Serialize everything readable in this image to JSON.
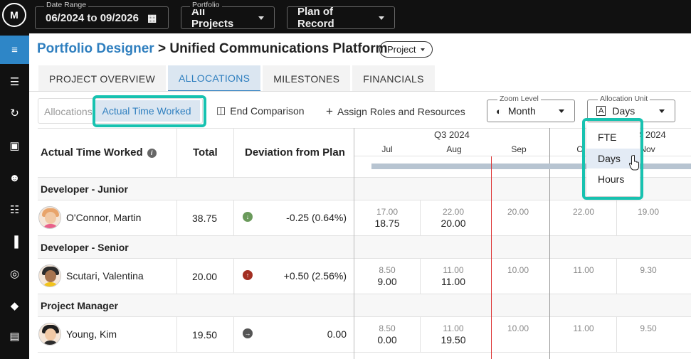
{
  "topbar": {
    "logo_text": "M",
    "date_range": {
      "legend": "Date Range",
      "value": "06/2024 to 09/2026"
    },
    "portfolio": {
      "legend": "Portfolio",
      "value": "All Projects"
    },
    "plan": {
      "value": "Plan of Record"
    }
  },
  "sidebar": {
    "items": [
      {
        "icon": "menu-lines-icon",
        "glyph": "≡",
        "active": true
      },
      {
        "icon": "person-list-icon",
        "glyph": "☰"
      },
      {
        "icon": "refresh-icon",
        "glyph": "↻"
      },
      {
        "icon": "badge-icon",
        "glyph": "▣"
      },
      {
        "icon": "people-icon",
        "glyph": "☻"
      },
      {
        "icon": "list-icon",
        "glyph": "☷"
      },
      {
        "icon": "columns-icon",
        "glyph": "▐"
      },
      {
        "icon": "target-icon",
        "glyph": "◎"
      },
      {
        "icon": "diamond-direction-icon",
        "glyph": "◆"
      },
      {
        "icon": "document-icon",
        "glyph": "▤"
      }
    ]
  },
  "header": {
    "breadcrumb": "Portfolio Designer",
    "separator": ">",
    "title": "Unified Communications Platform",
    "badge": "Project"
  },
  "tabs": [
    {
      "label": "PROJECT OVERVIEW"
    },
    {
      "label": "ALLOCATIONS",
      "active": true
    },
    {
      "label": "MILESTONES"
    },
    {
      "label": "FINANCIALS"
    }
  ],
  "toolbar": {
    "seg_allocations": "Allocations",
    "seg_actual": "Actual Time Worked",
    "end_comparison": "End Comparison",
    "assign_roles": "Assign Roles and Resources",
    "zoom": {
      "legend": "Zoom Level",
      "value": "Month"
    },
    "unit": {
      "legend": "Allocation Unit",
      "value": "Days"
    }
  },
  "table": {
    "col_name": "Actual Time Worked",
    "col_total": "Total",
    "col_deviation": "Deviation from Plan",
    "quarters": [
      "Q3 2024",
      "4 2024"
    ],
    "months": [
      "Jul",
      "Aug",
      "Sep",
      "O",
      "Nov"
    ],
    "groups": [
      {
        "role": "Developer - Junior",
        "person": {
          "name": "O'Connor, Martin",
          "total": "38.75",
          "deviation": "-0.25 (0.64%)",
          "dev_dir": "down",
          "cells": [
            {
              "top": "17.00",
              "bot": "18.75"
            },
            {
              "top": "22.00",
              "bot": "20.00"
            },
            {
              "top": "20.00"
            },
            {
              "top": "22.00"
            },
            {
              "top": "19.00"
            }
          ]
        }
      },
      {
        "role": "Developer - Senior",
        "person": {
          "name": "Scutari, Valentina",
          "total": "20.00",
          "deviation": "+0.50 (2.56%)",
          "dev_dir": "up",
          "cells": [
            {
              "top": "8.50",
              "bot": "9.00"
            },
            {
              "top": "11.00",
              "bot": "11.00"
            },
            {
              "top": "10.00"
            },
            {
              "top": "11.00"
            },
            {
              "top": "9.30"
            }
          ]
        }
      },
      {
        "role": "Project Manager",
        "person": {
          "name": "Young, Kim",
          "total": "19.50",
          "deviation": "0.00",
          "dev_dir": "right",
          "cells": [
            {
              "top": "8.50",
              "bot": "0.00"
            },
            {
              "top": "11.00",
              "bot": "19.50"
            },
            {
              "top": "10.00"
            },
            {
              "top": "11.00"
            },
            {
              "top": "9.50"
            }
          ]
        }
      }
    ]
  },
  "unit_menu": {
    "options": [
      "FTE",
      "Days",
      "Hours"
    ],
    "selected": "Days"
  },
  "colors": {
    "accent": "#2f7fbf",
    "highlight": "#17c2b0",
    "dev_down": "#6a9a5b",
    "dev_up": "#a32f22",
    "dev_neutral": "#555555"
  }
}
